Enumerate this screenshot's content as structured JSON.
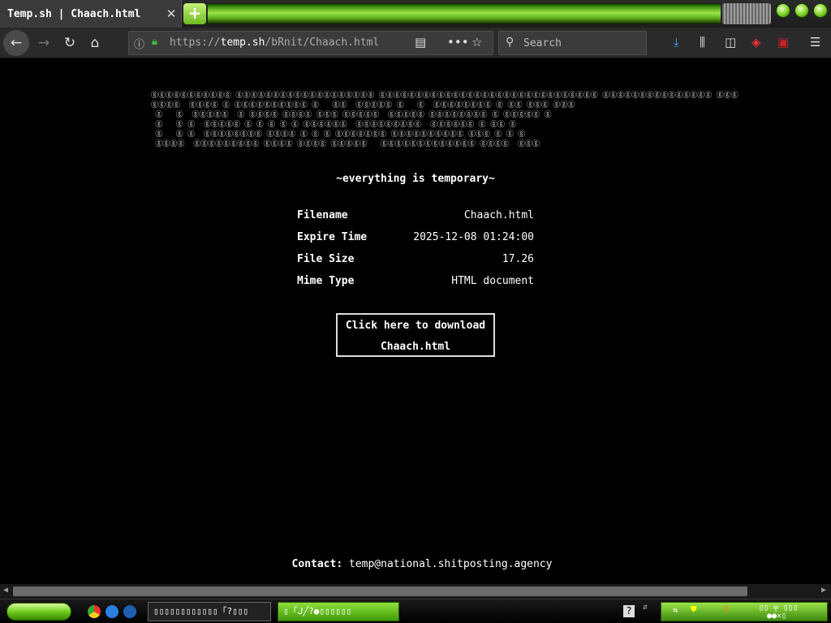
{
  "browser": {
    "tab_title": "Temp.sh | Chaach.html",
    "tab_close": "✕",
    "new_tab": "+",
    "url_prefix": "https://",
    "url_host": "temp.sh",
    "url_path": "/bRnit/Chaach.html",
    "search_placeholder": "Search"
  },
  "page": {
    "banner_lines": [
      "ⓖⓖⓖⓖⓖⓖⓖⓖⓖⓖⓖ ⓖⓖⓖⓖⓖⓖⓖⓖⓖⓖⓖⓖⓖⓖⓖⓖⓖⓖⓖ ⓖⓖⓖⓖⓖⓖⓖⓖⓖⓖⓖⓖⓖⓖⓖⓖⓖⓖⓖⓖⓖⓖⓖⓖⓖⓖⓖⓖⓖⓖ ⓖⓖⓖⓖⓖⓖⓖⓖⓖⓖⓖⓖⓖⓖⓖ ⓖⓖⓖ",
      "ⓖⓖⓖⓖ  ⓖⓖⓖⓖ ⓖ ⓖⓖⓖⓖⓖⓖⓖⓖⓖⓖ ⓖ   ⓖⓖ  ⓖⓖⓖⓖⓖ ⓖ   ⓖ  ⓖⓖⓖⓖⓖⓖⓖⓖ ⓖ ⓖⓖ ⓖⓖⓖ ⓖⓖⓖ",
      " ⓖ   ⓖ  ⓖⓖⓖⓖⓖ  ⓖ ⓖⓖⓖⓖ ⓖⓖⓖⓖ ⓖⓖⓖ ⓖⓖⓖⓖⓖ  ⓖⓖⓖⓖⓖ ⓖⓖⓖⓖⓖⓖⓖⓖ ⓖ ⓖⓖⓖⓖⓖ ⓖ",
      " ⓖ   ⓖ ⓖ  ⓖⓖⓖⓖⓖ ⓖ ⓖ ⓖ ⓖ ⓖ ⓖⓖⓖⓖⓖⓖ  ⓖⓖⓖⓖⓖⓖⓖⓖⓖ  ⓖⓖⓖⓖⓖⓖ ⓖ ⓖⓖ ⓖ",
      " ⓖ   ⓖ ⓖ  ⓖⓖⓖⓖⓖⓖⓖⓖ ⓖⓖⓖⓖ ⓖ ⓖ ⓖ ⓖⓖⓖⓖⓖⓖⓖ ⓖⓖⓖⓖⓖⓖⓖⓖⓖⓖ ⓖⓖⓖ ⓖ ⓖ ⓖ",
      " ⓖⓖⓖⓖ  ⓖⓖⓖⓖⓖⓖⓖⓖⓖ ⓖⓖⓖⓖ ⓖⓖⓖⓖ ⓖⓖⓖⓖⓖ   ⓖⓖⓖⓖⓖⓖⓖⓖⓖⓖⓖⓖⓖ ⓖⓖⓖⓖ  ⓖⓖⓖ"
    ],
    "tagline": "~everything is temporary~",
    "info": [
      {
        "label": "Filename",
        "value": "Chaach.html"
      },
      {
        "label": "Expire Time",
        "value": "2025-12-08 01:24:00"
      },
      {
        "label": "File Size",
        "value": "17.26"
      },
      {
        "label": "Mime Type",
        "value": "HTML document"
      }
    ],
    "download_line1": "Click here to download",
    "download_line2": "Chaach.html",
    "contact_label": "Contact:",
    "contact_email": "temp@national.shitposting.agency"
  },
  "taskbar": {
    "task1_label": "▯▯▯▯▯▯▯▯▯▯▯▯「?▯▯▯",
    "task2_label": "▯「ᒍ╱?●▯▯▯▯▯▯",
    "tray_text": "▯▯ ╤ ▯▯▯"
  },
  "colors": {
    "accent_green": "#7ccf22",
    "lock_green": "#3fc43f",
    "background": "#000000",
    "text": "#ffffff"
  }
}
